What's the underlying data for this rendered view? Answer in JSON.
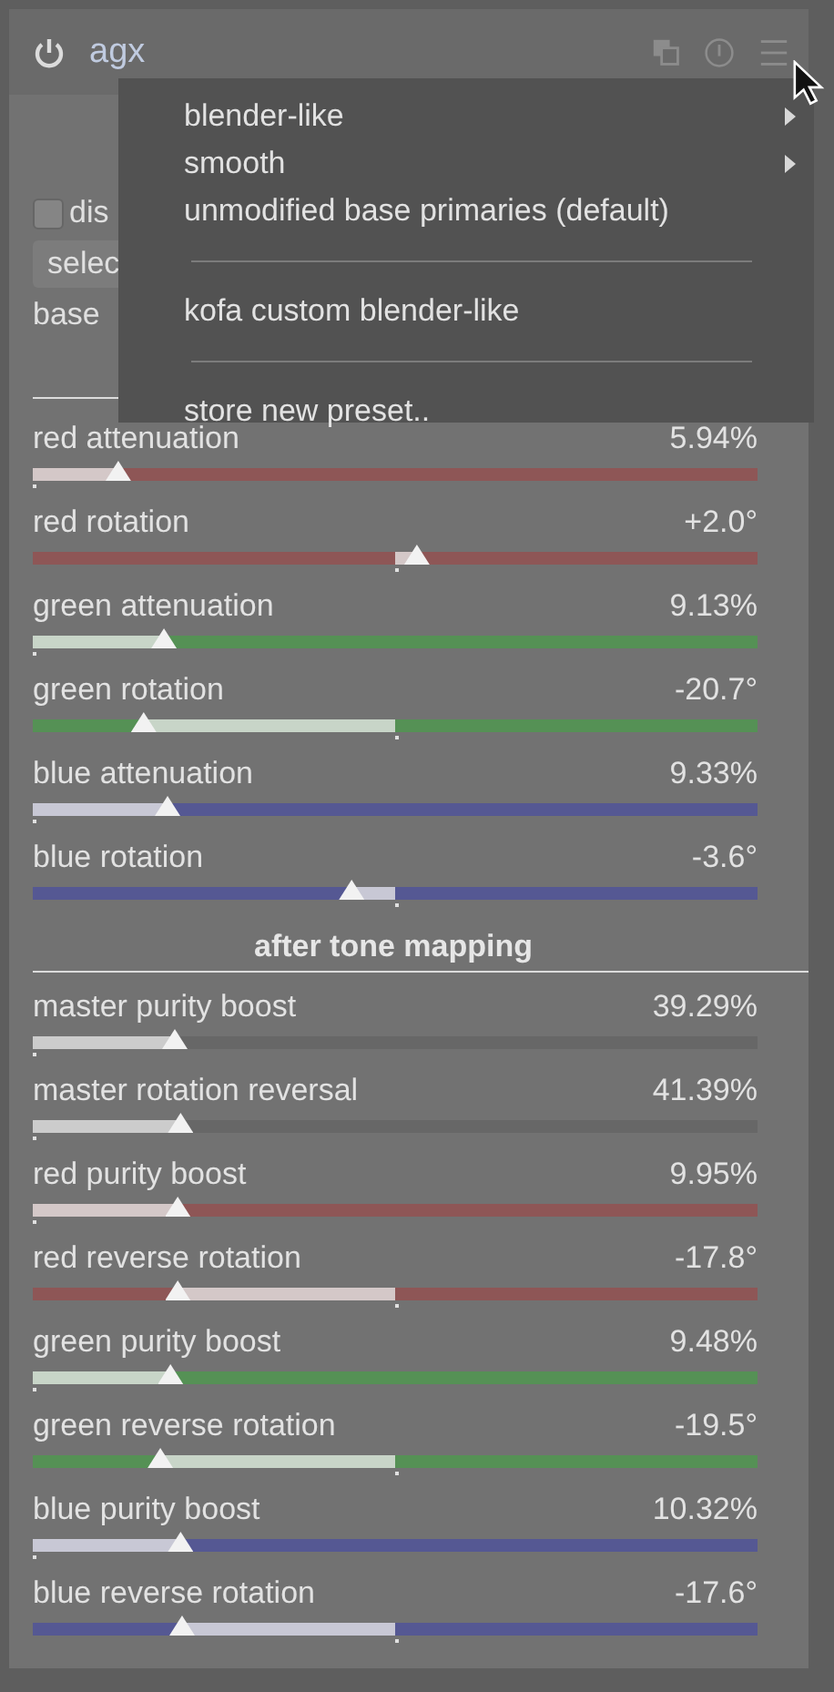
{
  "module": {
    "title": "agx",
    "enabled": true
  },
  "hidden_controls": {
    "checkbox": {
      "label": "dis",
      "checked": false
    },
    "dropdown": {
      "value": "selec"
    },
    "label": "base"
  },
  "presets_menu": [
    {
      "label": "blender-like",
      "submenu": true,
      "kind": "item"
    },
    {
      "label": "smooth",
      "submenu": true,
      "kind": "item"
    },
    {
      "label": "unmodified base primaries (default)",
      "submenu": false,
      "kind": "item"
    },
    {
      "kind": "separator"
    },
    {
      "label": "kofa custom blender-like",
      "submenu": false,
      "kind": "item"
    },
    {
      "kind": "separator"
    },
    {
      "label": "store new preset..",
      "submenu": false,
      "kind": "item"
    }
  ],
  "sliders": [
    {
      "label": "red attenuation",
      "value": "5.94%",
      "level": 0.118,
      "kind": "unipolar",
      "color": "#8e5656"
    },
    {
      "label": "red rotation",
      "value": "+2.0°",
      "level": 0.53,
      "kind": "bipolar",
      "color": "#8e5656"
    },
    {
      "label": "green attenuation",
      "value": "9.13%",
      "level": 0.181,
      "kind": "unipolar",
      "color": "#559155"
    },
    {
      "label": "green rotation",
      "value": "-20.7°",
      "level": 0.153,
      "kind": "bipolar",
      "color": "#559155"
    },
    {
      "label": "blue attenuation",
      "value": "9.33%",
      "level": 0.186,
      "kind": "unipolar",
      "color": "#555893"
    },
    {
      "label": "blue rotation",
      "value": "-3.6°",
      "level": 0.44,
      "kind": "bipolar",
      "color": "#555893"
    }
  ],
  "section": "after tone mapping",
  "sliders_after": [
    {
      "label": "master purity boost",
      "value": "39.29%",
      "level": 0.196,
      "kind": "unipolar",
      "color": "#676767"
    },
    {
      "label": "master rotation reversal",
      "value": "41.39%",
      "level": 0.204,
      "kind": "unipolar",
      "color": "#676767"
    },
    {
      "label": "red purity boost",
      "value": "9.95%",
      "level": 0.2,
      "kind": "unipolar",
      "color": "#8e5656"
    },
    {
      "label": "red reverse rotation",
      "value": "-17.8°",
      "level": 0.2,
      "kind": "bipolar",
      "color": "#8e5656"
    },
    {
      "label": "green purity boost",
      "value": "9.48%",
      "level": 0.19,
      "kind": "unipolar",
      "color": "#559155"
    },
    {
      "label": "green reverse rotation",
      "value": "-19.5°",
      "level": 0.176,
      "kind": "bipolar",
      "color": "#559155"
    },
    {
      "label": "blue purity boost",
      "value": "10.32%",
      "level": 0.204,
      "kind": "unipolar",
      "color": "#555893"
    },
    {
      "label": "blue reverse rotation",
      "value": "-17.6°",
      "level": 0.206,
      "kind": "bipolar",
      "color": "#555893"
    }
  ]
}
